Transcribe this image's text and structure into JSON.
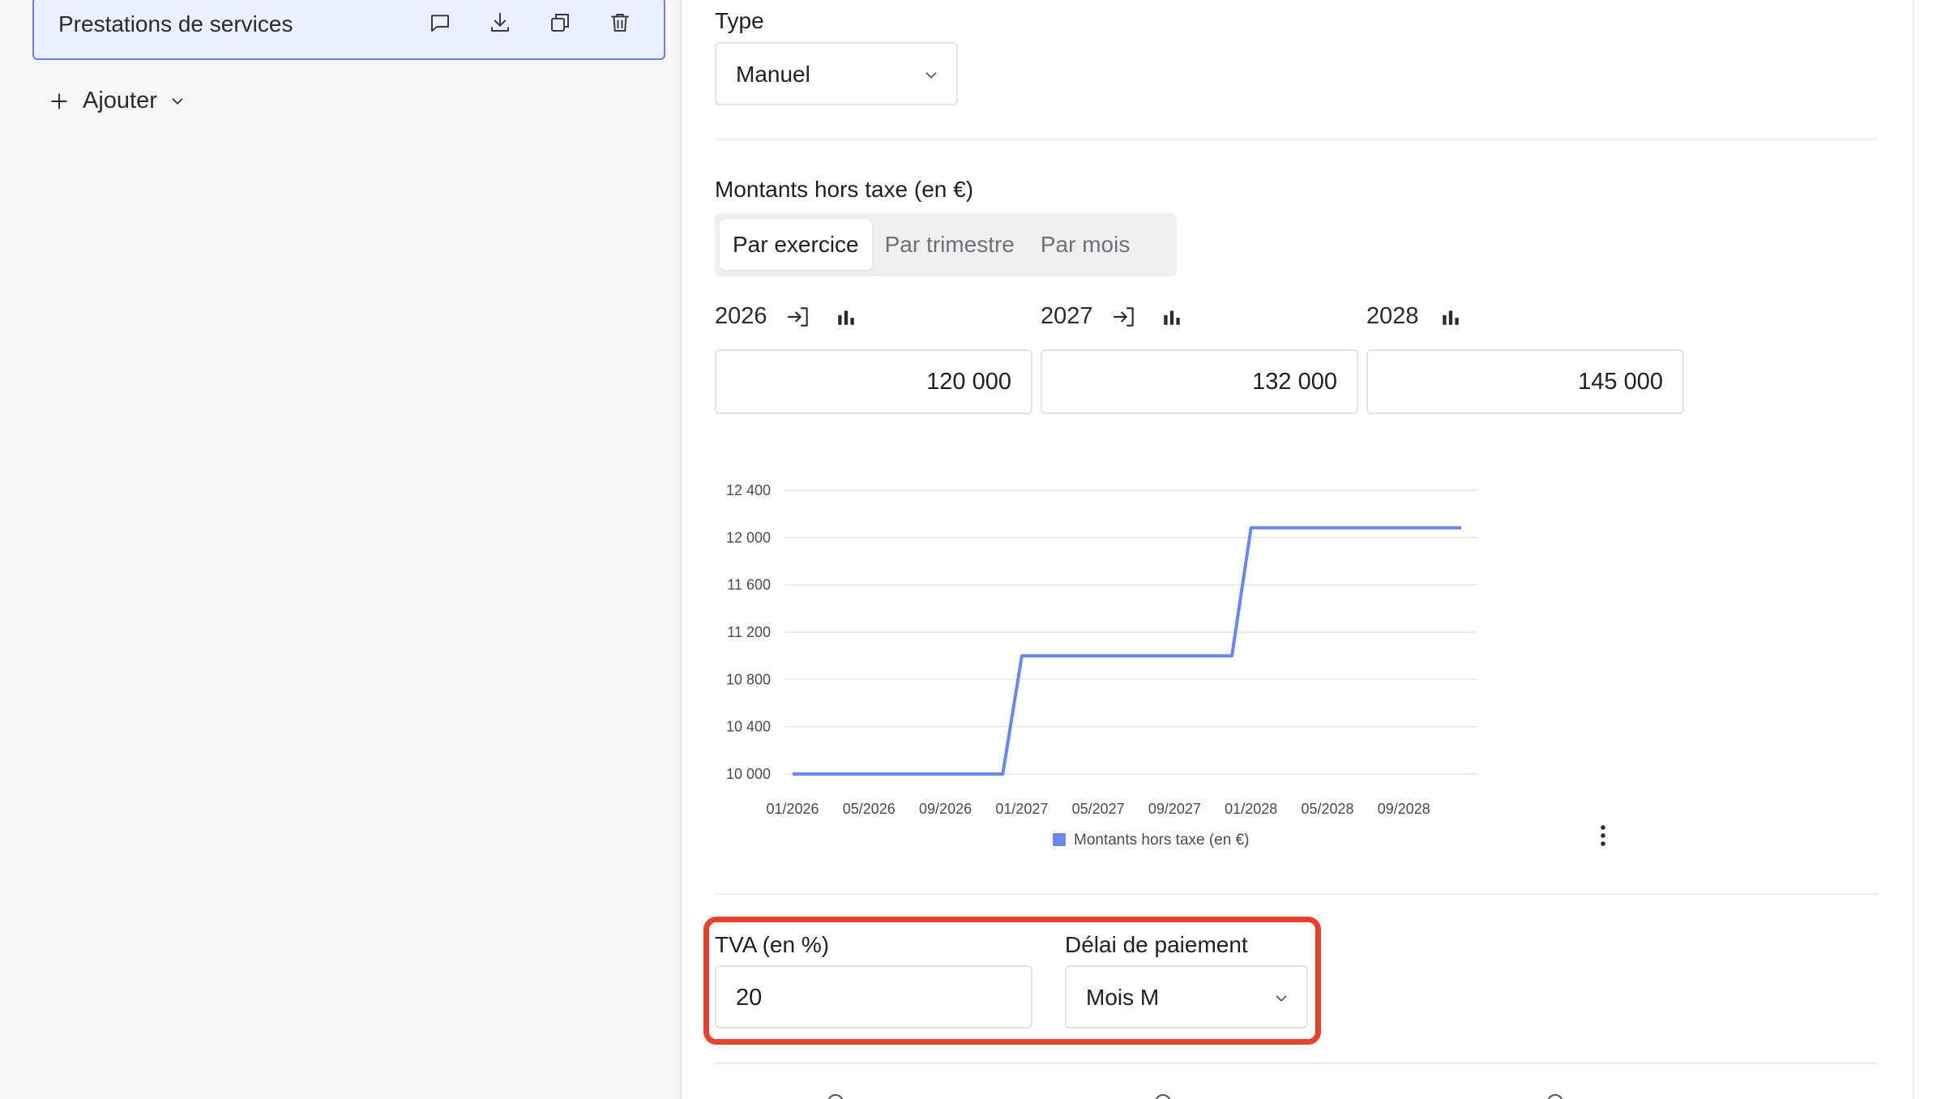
{
  "sidebar": {
    "selected_item": "Prestations de services",
    "add_label": "Ajouter",
    "item_action_icons": [
      "comment-icon",
      "download-icon",
      "duplicate-icon",
      "trash-icon"
    ]
  },
  "type_field": {
    "label": "Type",
    "value": "Manuel"
  },
  "amounts": {
    "label": "Montants hors taxe (en €)",
    "tabs": [
      {
        "label": "Par exercice",
        "active": true
      },
      {
        "label": "Par trimestre",
        "active": false
      },
      {
        "label": "Par mois",
        "active": false
      }
    ],
    "years": [
      {
        "year": "2026",
        "value": "120 000",
        "has_apply_icon": true
      },
      {
        "year": "2027",
        "value": "132 000",
        "has_apply_icon": true
      },
      {
        "year": "2028",
        "value": "145 000",
        "has_apply_icon": false
      }
    ]
  },
  "chart_data": {
    "type": "line",
    "title": "",
    "xlabel": "",
    "ylabel": "",
    "ylim": [
      10000,
      12400
    ],
    "y_ticks": [
      "10 000",
      "10 400",
      "10 800",
      "11 200",
      "11 600",
      "12 000",
      "12 400"
    ],
    "x_ticks": [
      "01/2026",
      "05/2026",
      "09/2026",
      "01/2027",
      "05/2027",
      "09/2027",
      "01/2028",
      "05/2028",
      "09/2028"
    ],
    "legend": "bottom-center",
    "grid": true,
    "color": "#6b86f0",
    "series": [
      {
        "name": "Montants hors taxe (en €)",
        "x": [
          "01/2026",
          "02/2026",
          "03/2026",
          "04/2026",
          "05/2026",
          "06/2026",
          "07/2026",
          "08/2026",
          "09/2026",
          "10/2026",
          "11/2026",
          "12/2026",
          "01/2027",
          "02/2027",
          "03/2027",
          "04/2027",
          "05/2027",
          "06/2027",
          "07/2027",
          "08/2027",
          "09/2027",
          "10/2027",
          "11/2027",
          "12/2027",
          "01/2028",
          "02/2028",
          "03/2028",
          "04/2028",
          "05/2028",
          "06/2028",
          "07/2028",
          "08/2028",
          "09/2028",
          "10/2028",
          "11/2028",
          "12/2028"
        ],
        "values": [
          10000,
          10000,
          10000,
          10000,
          10000,
          10000,
          10000,
          10000,
          10000,
          10000,
          10000,
          10000,
          11000,
          11000,
          11000,
          11000,
          11000,
          11000,
          11000,
          11000,
          11000,
          11000,
          11000,
          11000,
          12083,
          12083,
          12083,
          12083,
          12083,
          12083,
          12083,
          12083,
          12083,
          12083,
          12083,
          12083
        ]
      }
    ]
  },
  "vat": {
    "label": "TVA (en %)",
    "value": "20"
  },
  "payment_delay": {
    "label": "Délai de paiement",
    "value": "Mois M"
  },
  "colors": {
    "accent": "#6b7ff0",
    "highlight": "#e5422c",
    "line": "#6b86f0"
  }
}
